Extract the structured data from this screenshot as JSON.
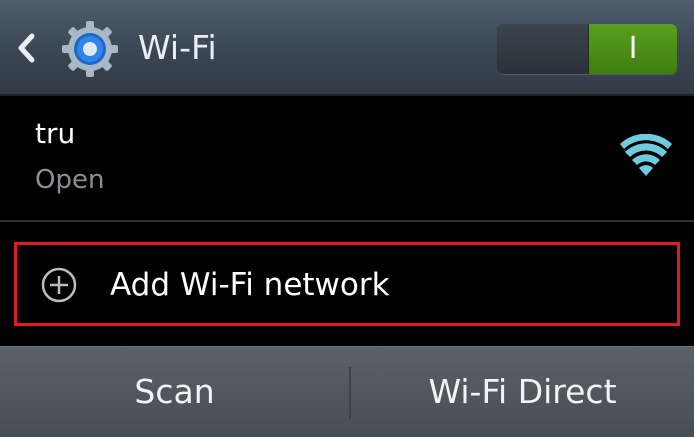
{
  "header": {
    "title": "Wi-Fi",
    "back_icon": "chevron-left-icon",
    "settings_icon": "gear-icon",
    "toggle": {
      "state": "on",
      "label": "I",
      "on_color": "#4c9218"
    }
  },
  "networks": [
    {
      "name": "tru",
      "status": "Open",
      "signal_icon": "wifi-signal-icon",
      "signal_color": "#6fcbe0"
    }
  ],
  "add_network": {
    "label": "Add Wi-Fi network",
    "icon": "plus-circle-icon",
    "highlight_color": "#e01b24"
  },
  "bottom_bar": {
    "scan_label": "Scan",
    "wifi_direct_label": "Wi-Fi Direct"
  }
}
